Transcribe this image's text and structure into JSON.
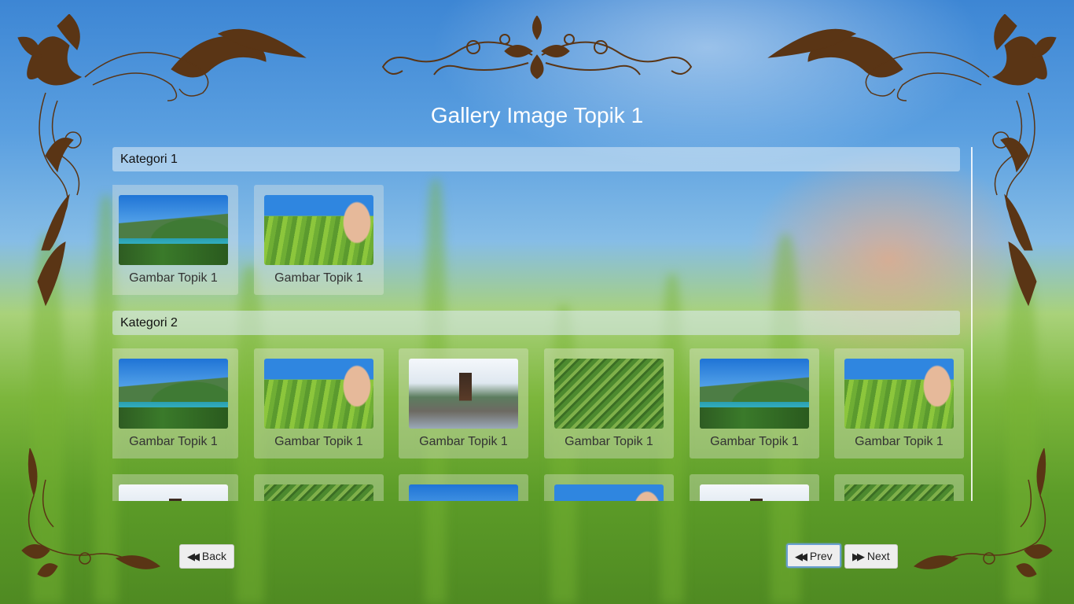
{
  "page": {
    "title": "Gallery Image Topik 1"
  },
  "colors": {
    "ornament": "#5a3515",
    "title": "#ffffff",
    "focus_ring": "#6a9fd1"
  },
  "categories": [
    {
      "label": "Kategori 1",
      "items": [
        {
          "caption": "Gambar Topik 1",
          "image": "lake-mountain"
        },
        {
          "caption": "Gambar Topik 1",
          "image": "wheat-hand"
        }
      ]
    },
    {
      "label": "Kategori 2",
      "items": [
        {
          "caption": "Gambar Topik 1",
          "image": "lake-mountain"
        },
        {
          "caption": "Gambar Topik 1",
          "image": "wheat-hand"
        },
        {
          "caption": "Gambar Topik 1",
          "image": "temple-pagoda"
        },
        {
          "caption": "Gambar Topik 1",
          "image": "rice-terrace"
        },
        {
          "caption": "Gambar Topik 1",
          "image": "lake-mountain"
        },
        {
          "caption": "Gambar Topik 1",
          "image": "wheat-hand"
        }
      ]
    }
  ],
  "nav": {
    "back": {
      "label": "Back",
      "icon": "fast-backward-icon"
    },
    "prev": {
      "label": "Prev",
      "icon": "fast-backward-icon"
    },
    "next": {
      "label": "Next",
      "icon": "fast-forward-icon"
    }
  }
}
